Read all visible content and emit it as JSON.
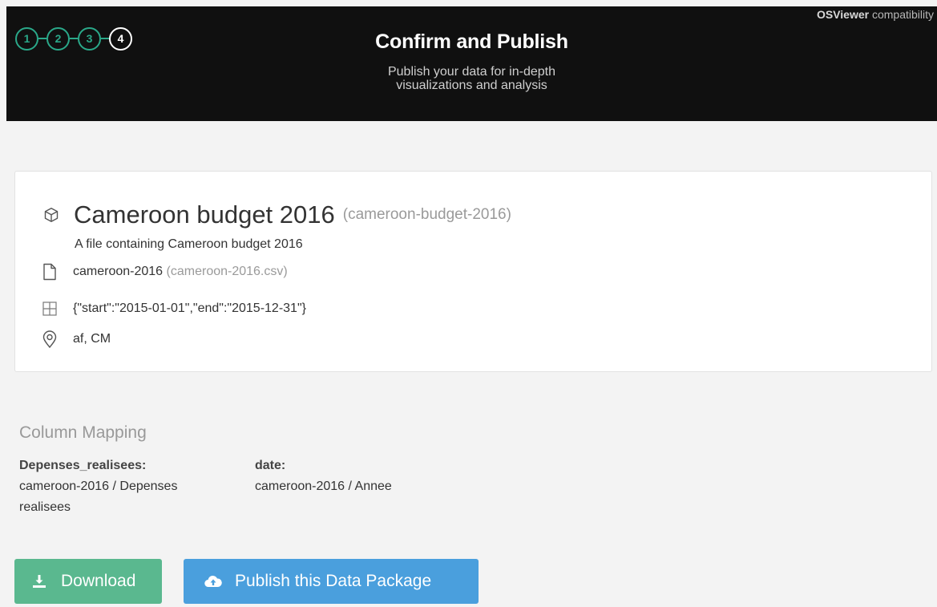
{
  "header": {
    "steps": [
      "1",
      "2",
      "3",
      "4"
    ],
    "active_step": "4",
    "compat_bold": "OSViewer",
    "compat_rest": " compatibility",
    "title": "Confirm and Publish",
    "subtitle_line1": "Publish your data for in-depth",
    "subtitle_line2": "visualizations and analysis"
  },
  "package": {
    "title": "Cameroon budget 2016",
    "slug": "(cameroon-budget-2016)",
    "description": "A file containing Cameroon budget 2016",
    "resource_name": "cameroon-2016",
    "resource_file": "(cameroon-2016.csv)",
    "temporal": "{\"start\":\"2015-01-01\",\"end\":\"2015-12-31\"}",
    "regions": "af, CM",
    "icons": {
      "package": "cube-icon",
      "resource": "file-icon",
      "temporal": "table-grid-icon",
      "regions": "map-pin-icon"
    }
  },
  "mapping": {
    "heading": "Column Mapping",
    "columns": [
      {
        "key": "Depenses_realisees:",
        "value": "cameroon-2016 / Depenses realisees"
      },
      {
        "key": "date:",
        "value": "cameroon-2016 / Annee"
      }
    ]
  },
  "actions": {
    "download_label": "Download",
    "publish_label": "Publish this Data Package",
    "download_icon": "download-icon",
    "publish_icon": "cloud-upload-icon"
  },
  "colors": {
    "step_accent": "#2aa889",
    "download_button": "#5ab88f",
    "publish_button": "#4a9fdd",
    "header_bg": "#101010"
  }
}
